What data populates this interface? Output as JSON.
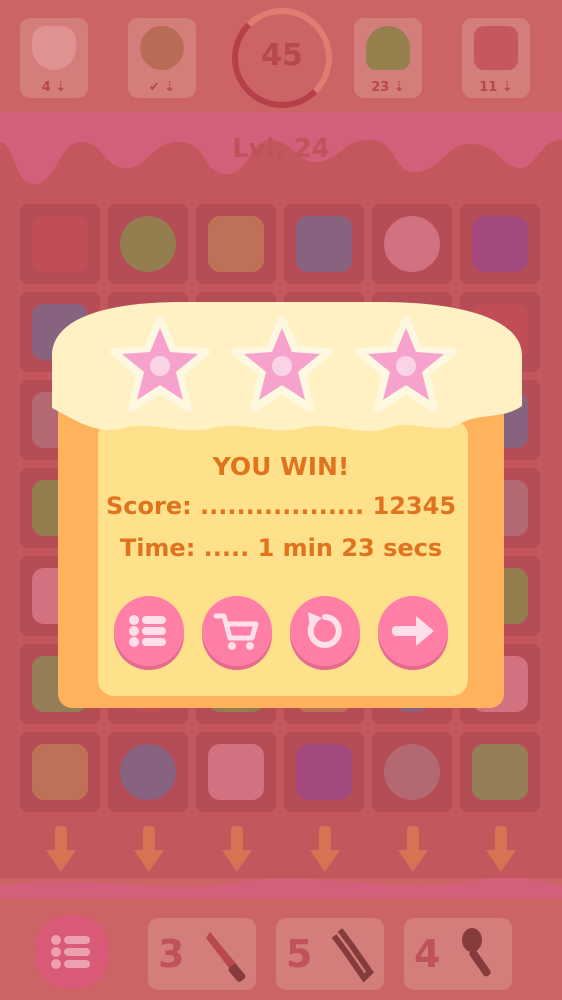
{
  "hud": {
    "goals": [
      {
        "name": "tooth",
        "count": "4 ⇣"
      },
      {
        "name": "cookie",
        "count": "✔ ⇣"
      },
      {
        "name": "gumdrop",
        "count": "23 ⇣"
      },
      {
        "name": "marshmallow",
        "count": "11 ⇣"
      }
    ],
    "moves_left": "45",
    "level": "Lvl. 24"
  },
  "dialog": {
    "title": "YOU WIN!",
    "score_line": "Score: .................. 12345",
    "time_line": "Time: ..... 1 min 23 secs",
    "stars_earned": 3,
    "buttons": [
      "menu",
      "shop",
      "replay",
      "next"
    ]
  },
  "tools": [
    {
      "count": "3",
      "item": "knife"
    },
    {
      "count": "5",
      "item": "fork"
    },
    {
      "count": "4",
      "item": "spoon"
    }
  ],
  "colors": {
    "accent": "#ff7fa6",
    "text": "#e0741e",
    "panel": "#ffe08b"
  }
}
